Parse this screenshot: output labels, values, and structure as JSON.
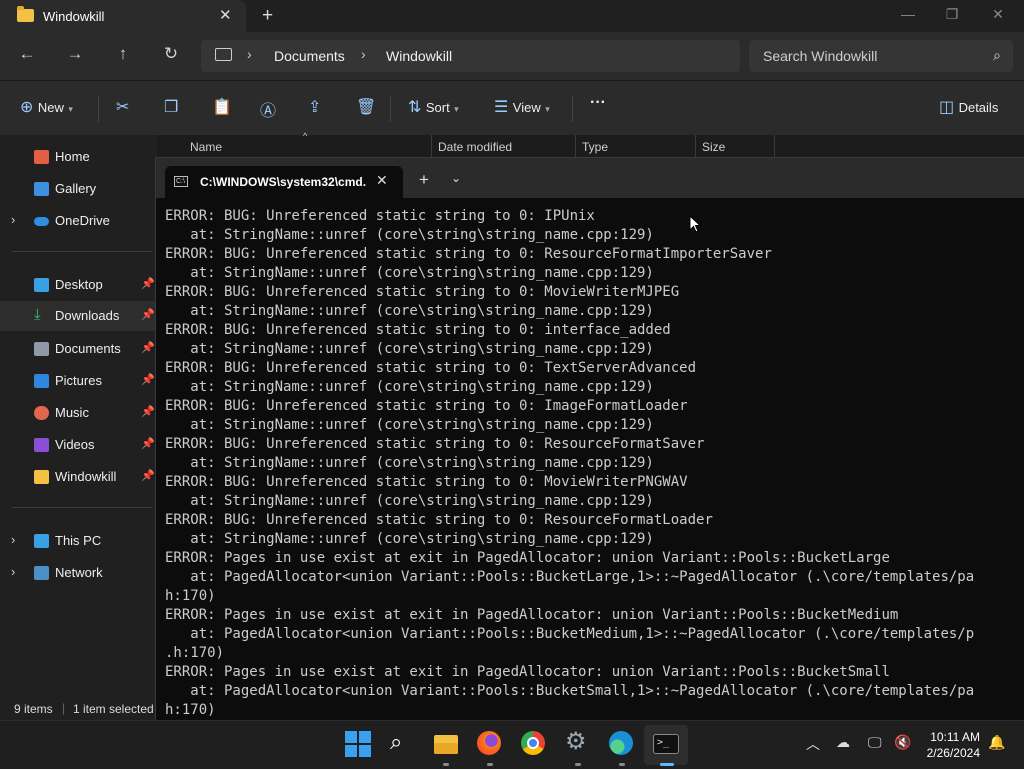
{
  "explorer": {
    "tab_title": "Windowkill",
    "breadcrumbs": [
      "Documents",
      "Windowkill"
    ],
    "search_placeholder": "Search Windowkill",
    "toolbar": {
      "new_label": "New",
      "sort_label": "Sort",
      "view_label": "View",
      "more_label": "···",
      "details_label": "Details"
    },
    "columns": [
      "Name",
      "Date modified",
      "Type",
      "Size"
    ],
    "sidebar": {
      "items": [
        {
          "label": "Home"
        },
        {
          "label": "Gallery"
        },
        {
          "label": "OneDrive"
        },
        {
          "label": "Desktop"
        },
        {
          "label": "Downloads"
        },
        {
          "label": "Documents"
        },
        {
          "label": "Pictures"
        },
        {
          "label": "Music"
        },
        {
          "label": "Videos"
        },
        {
          "label": "Windowkill"
        },
        {
          "label": "This PC"
        },
        {
          "label": "Network"
        }
      ]
    },
    "status": {
      "items": "9 items",
      "selected": "1 item selected"
    }
  },
  "terminal": {
    "tab_title": "C:\\WINDOWS\\system32\\cmd.",
    "lines": [
      "ERROR: BUG: Unreferenced static string to 0: IPUnix",
      "   at: StringName::unref (core\\string\\string_name.cpp:129)",
      "ERROR: BUG: Unreferenced static string to 0: ResourceFormatImporterSaver",
      "   at: StringName::unref (core\\string\\string_name.cpp:129)",
      "ERROR: BUG: Unreferenced static string to 0: MovieWriterMJPEG",
      "   at: StringName::unref (core\\string\\string_name.cpp:129)",
      "ERROR: BUG: Unreferenced static string to 0: interface_added",
      "   at: StringName::unref (core\\string\\string_name.cpp:129)",
      "ERROR: BUG: Unreferenced static string to 0: TextServerAdvanced",
      "   at: StringName::unref (core\\string\\string_name.cpp:129)",
      "ERROR: BUG: Unreferenced static string to 0: ImageFormatLoader",
      "   at: StringName::unref (core\\string\\string_name.cpp:129)",
      "ERROR: BUG: Unreferenced static string to 0: ResourceFormatSaver",
      "   at: StringName::unref (core\\string\\string_name.cpp:129)",
      "ERROR: BUG: Unreferenced static string to 0: MovieWriterPNGWAV",
      "   at: StringName::unref (core\\string\\string_name.cpp:129)",
      "ERROR: BUG: Unreferenced static string to 0: ResourceFormatLoader",
      "   at: StringName::unref (core\\string\\string_name.cpp:129)",
      "ERROR: Pages in use exist at exit in PagedAllocator: union Variant::Pools::BucketLarge",
      "   at: PagedAllocator<union Variant::Pools::BucketLarge,1>::~PagedAllocator (.\\core/templates/pa",
      "h:170)",
      "ERROR: Pages in use exist at exit in PagedAllocator: union Variant::Pools::BucketMedium",
      "   at: PagedAllocator<union Variant::Pools::BucketMedium,1>::~PagedAllocator (.\\core/templates/p",
      ".h:170)",
      "ERROR: Pages in use exist at exit in PagedAllocator: union Variant::Pools::BucketSmall",
      "   at: PagedAllocator<union Variant::Pools::BucketSmall,1>::~PagedAllocator (.\\core/templates/pa",
      "h:170)"
    ]
  },
  "taskbar": {
    "time": "10:11 AM",
    "date": "2/26/2024"
  },
  "colors": {
    "accent": "#9ccbff",
    "folder": "#f3c244",
    "terminal_bg": "#0c0c0c"
  }
}
